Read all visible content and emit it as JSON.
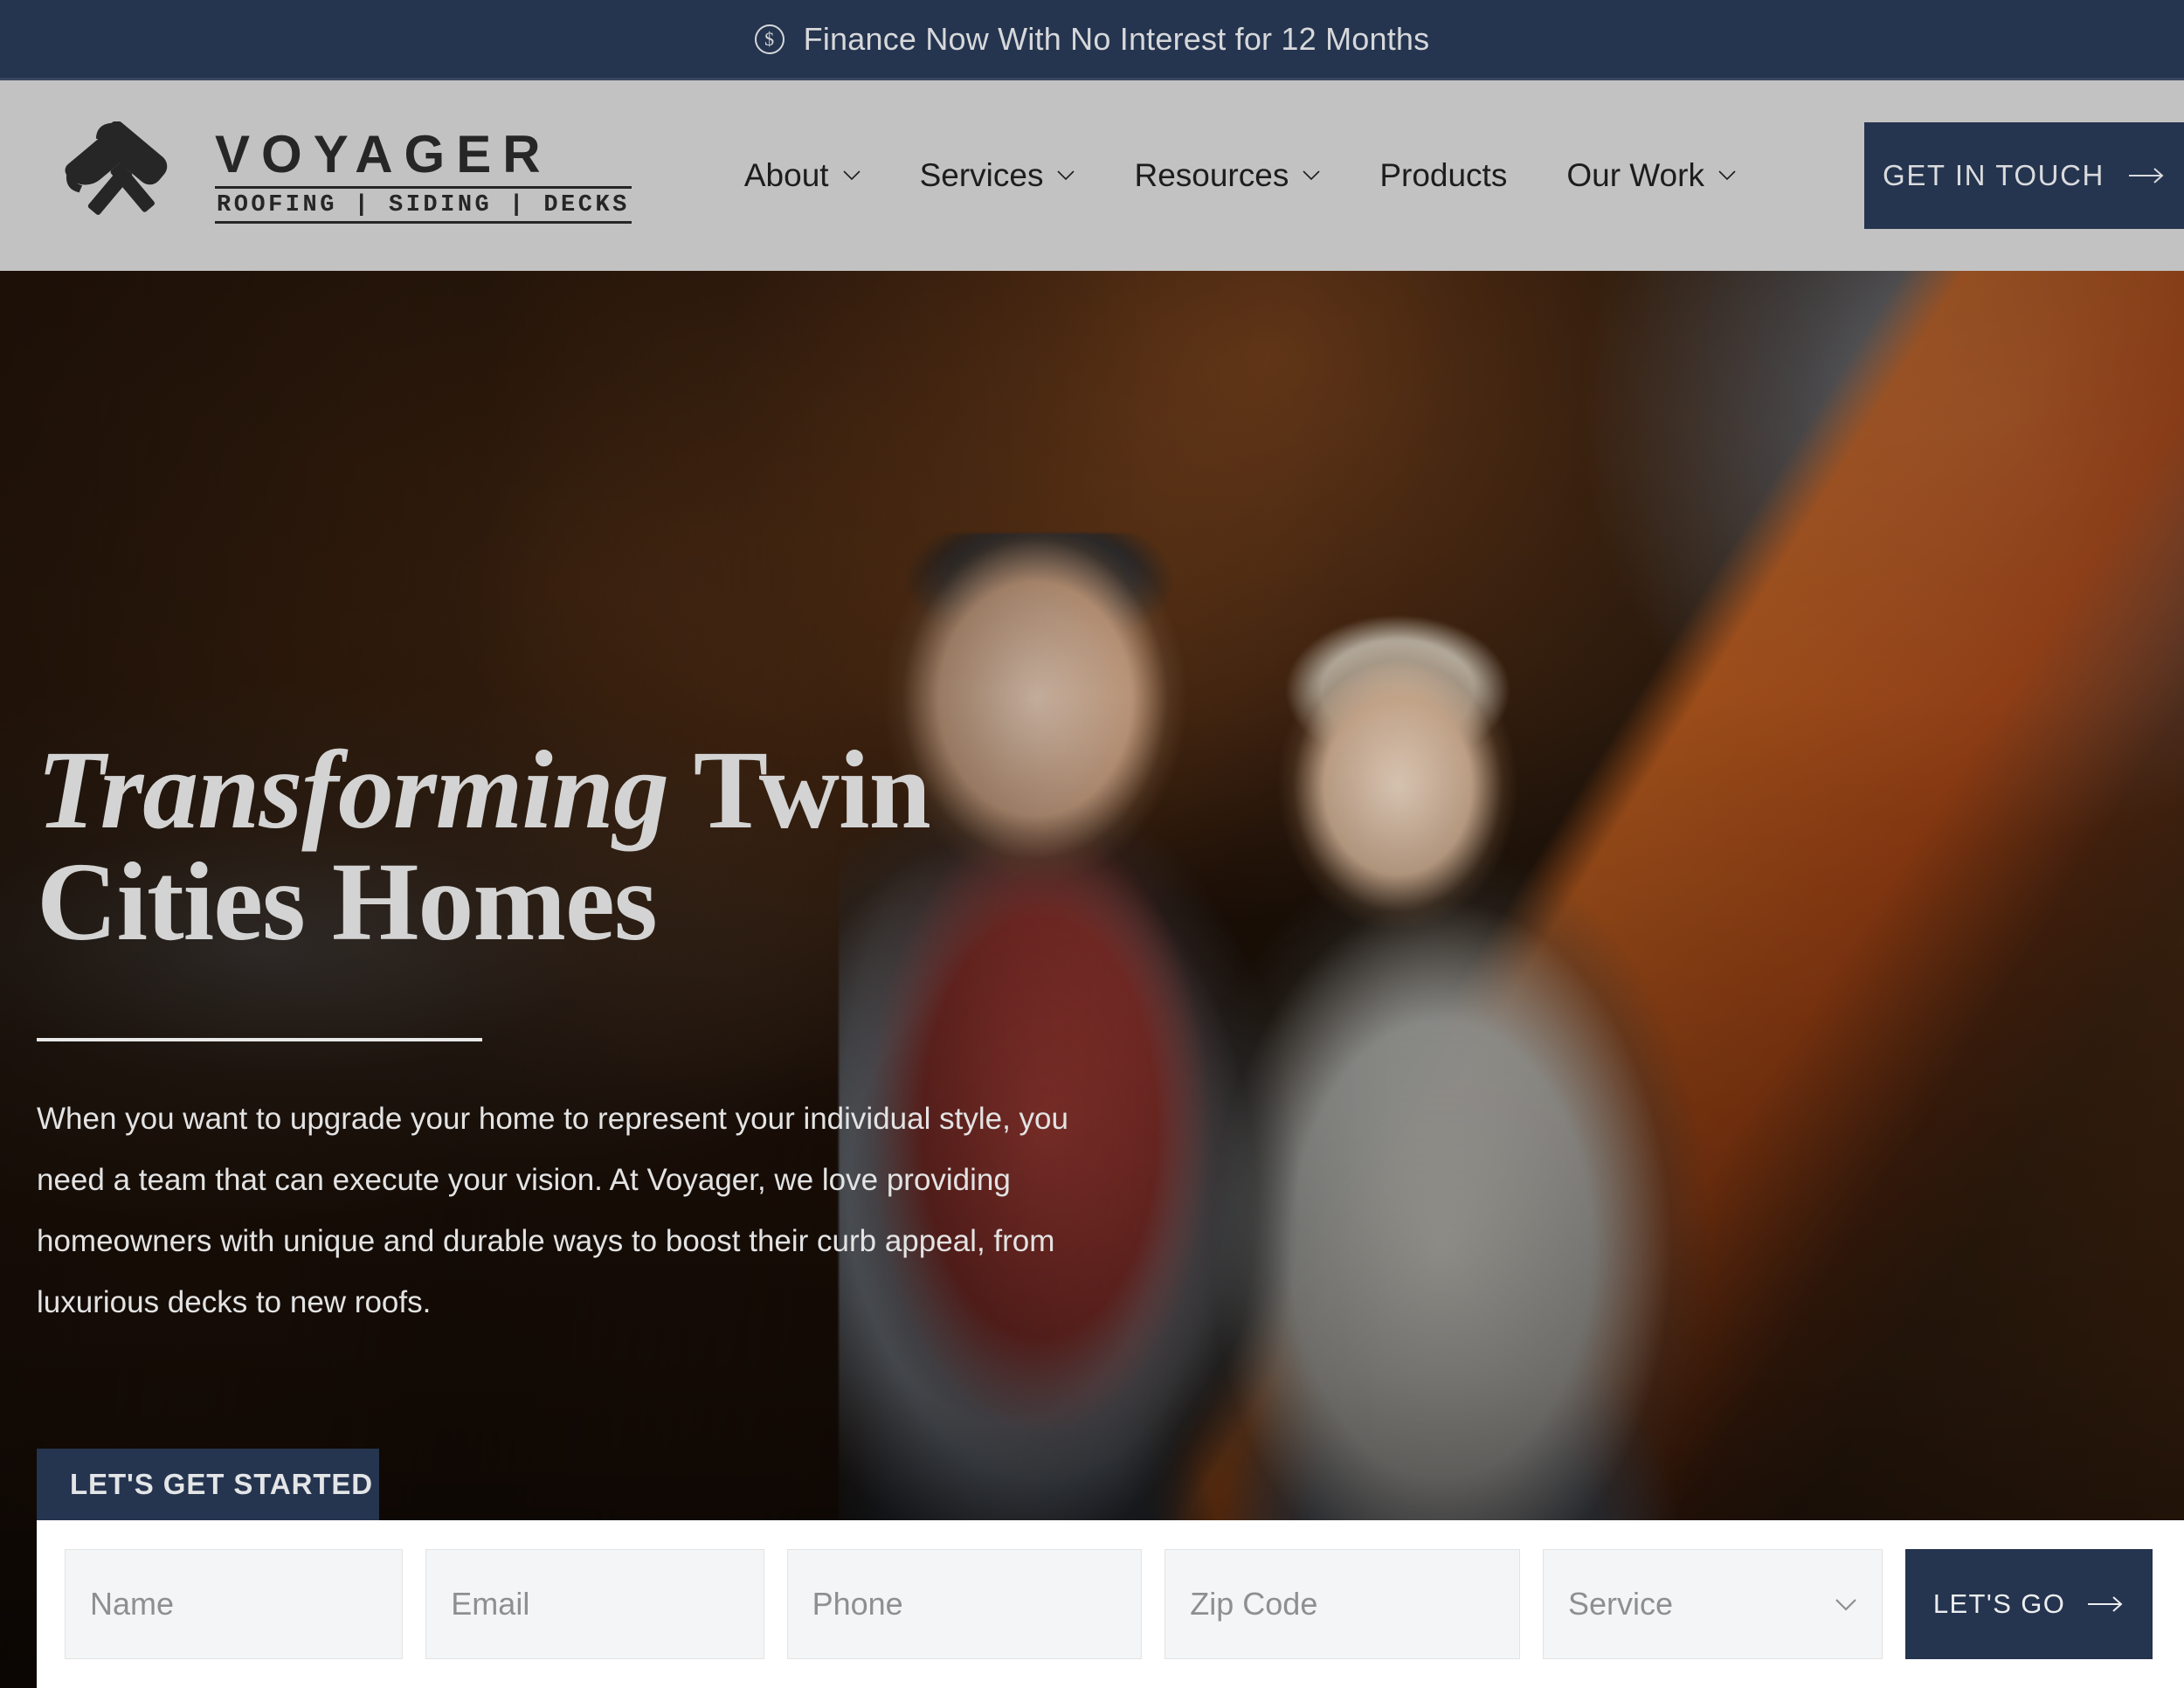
{
  "announcement": {
    "icon": "dollar-circle-icon",
    "text": "Finance Now With No Interest for 12 Months"
  },
  "header": {
    "logo": {
      "icon": "crossed-hammers-icon",
      "wordmark": "VOYAGER",
      "tagline": "ROOFING | SIDING | DECKS"
    },
    "nav": [
      {
        "label": "About",
        "has_dropdown": true
      },
      {
        "label": "Services",
        "has_dropdown": true
      },
      {
        "label": "Resources",
        "has_dropdown": true
      },
      {
        "label": "Products",
        "has_dropdown": false
      },
      {
        "label": "Our Work",
        "has_dropdown": true
      }
    ],
    "cta": {
      "label": "GET IN TOUCH",
      "icon": "arrow-right-icon"
    }
  },
  "hero": {
    "headline_italic": "Transforming",
    "headline_rest": " Twin Cities Homes",
    "body": "When you want to upgrade your home to represent your individual style, you need a team that can execute your vision. At Voyager, we love providing homeowners with unique and durable ways to boost their curb appeal, from luxurious decks to new roofs."
  },
  "form": {
    "tab_label": "LET'S GET STARTED",
    "fields": [
      {
        "name": "name",
        "placeholder": "Name"
      },
      {
        "name": "email",
        "placeholder": "Email"
      },
      {
        "name": "phone",
        "placeholder": "Phone"
      },
      {
        "name": "zip",
        "placeholder": "Zip Code"
      }
    ],
    "service_select": {
      "placeholder": "Service",
      "icon": "chevron-down-icon"
    },
    "submit": {
      "label": "LET'S GO",
      "icon": "arrow-right-icon"
    }
  },
  "colors": {
    "navy": "#25344f",
    "header_gray": "#c2c2c2",
    "field_gray": "#f4f5f6",
    "text_light": "#d6d8da"
  }
}
